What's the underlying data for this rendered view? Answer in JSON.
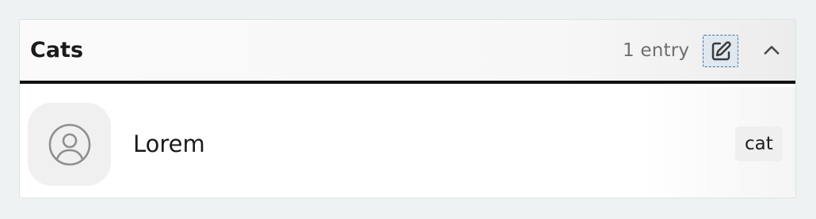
{
  "section": {
    "title": "Cats",
    "entry_count": "1 entry",
    "icons": {
      "edit": "edit-icon",
      "collapse": "chevron-up-icon",
      "avatar": "user-circle-icon"
    },
    "colors": {
      "header_divider": "#111111",
      "edit_focus_outline": "#3f73a8",
      "muted_text": "#6d6d6d"
    }
  },
  "entries": [
    {
      "name": "Lorem",
      "tag": "cat"
    }
  ]
}
